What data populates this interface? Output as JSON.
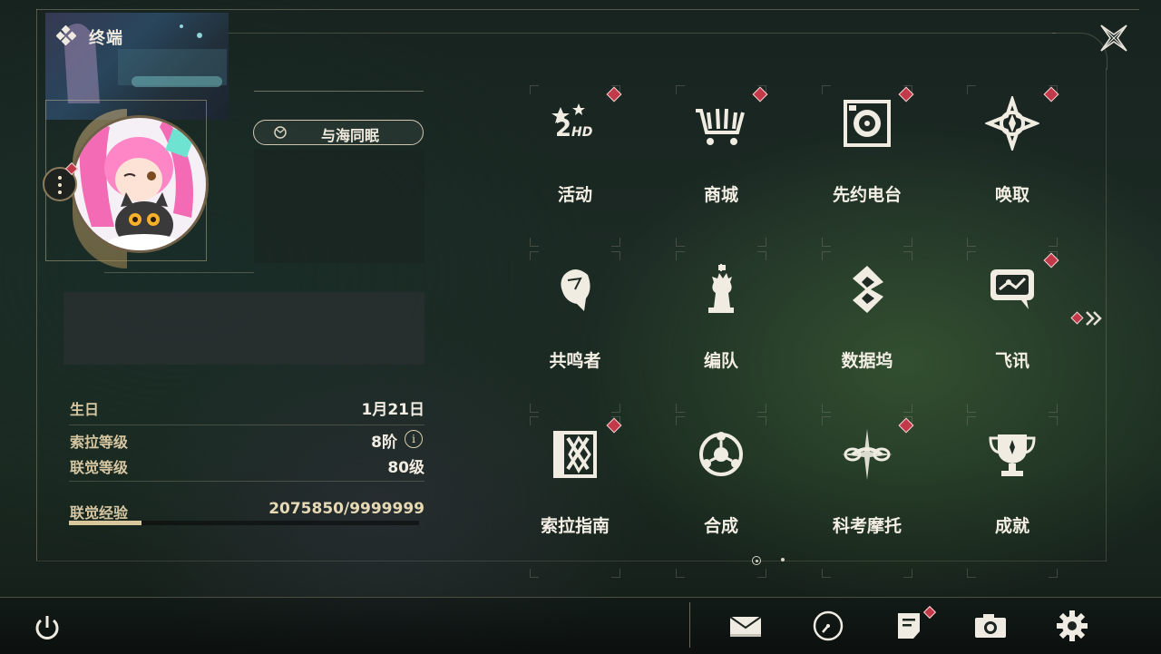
{
  "header": {
    "title": "终端"
  },
  "profile": {
    "title_badge": "与海同眠",
    "rows": [
      {
        "label": "生日",
        "value": "1月21日"
      },
      {
        "label": "索拉等级",
        "value": "8阶"
      },
      {
        "label": "联觉等级",
        "value": "80级"
      }
    ],
    "exp": {
      "label": "联觉经验",
      "value": "2075850/9999999",
      "progress": 0.2076
    },
    "info_icon_glyph": "i"
  },
  "grid": {
    "tiles": [
      {
        "label": "活动",
        "icon": "event-2hd-icon",
        "badge": true
      },
      {
        "label": "商城",
        "icon": "shop-cart-icon",
        "badge": true
      },
      {
        "label": "先约电台",
        "icon": "radio-icon",
        "badge": true
      },
      {
        "label": "唤取",
        "icon": "convene-icon",
        "badge": true
      },
      {
        "label": "共鸣者",
        "icon": "resonator-icon",
        "badge": false
      },
      {
        "label": "编队",
        "icon": "team-chess-icon",
        "badge": false
      },
      {
        "label": "数据坞",
        "icon": "data-bank-icon",
        "badge": false
      },
      {
        "label": "飞讯",
        "icon": "message-bubble-icon",
        "badge": true
      },
      {
        "label": "索拉指南",
        "icon": "guidebook-icon",
        "badge": true
      },
      {
        "label": "合成",
        "icon": "synthesis-icon",
        "badge": false
      },
      {
        "label": "科考摩托",
        "icon": "motorbike-icon",
        "badge": true
      },
      {
        "label": "成就",
        "icon": "trophy-icon",
        "badge": false
      }
    ],
    "pages": {
      "current": 1,
      "total": 2
    }
  },
  "bottom_bar": [
    {
      "icon": "mail-icon"
    },
    {
      "icon": "clock-icon"
    },
    {
      "icon": "notice-icon",
      "badge": true
    },
    {
      "icon": "camera-icon"
    },
    {
      "icon": "settings-gear-icon"
    }
  ],
  "colors": {
    "accent_gold": "#d8c79a",
    "badge_red": "#c23a4a",
    "text": "#f4efe4"
  }
}
